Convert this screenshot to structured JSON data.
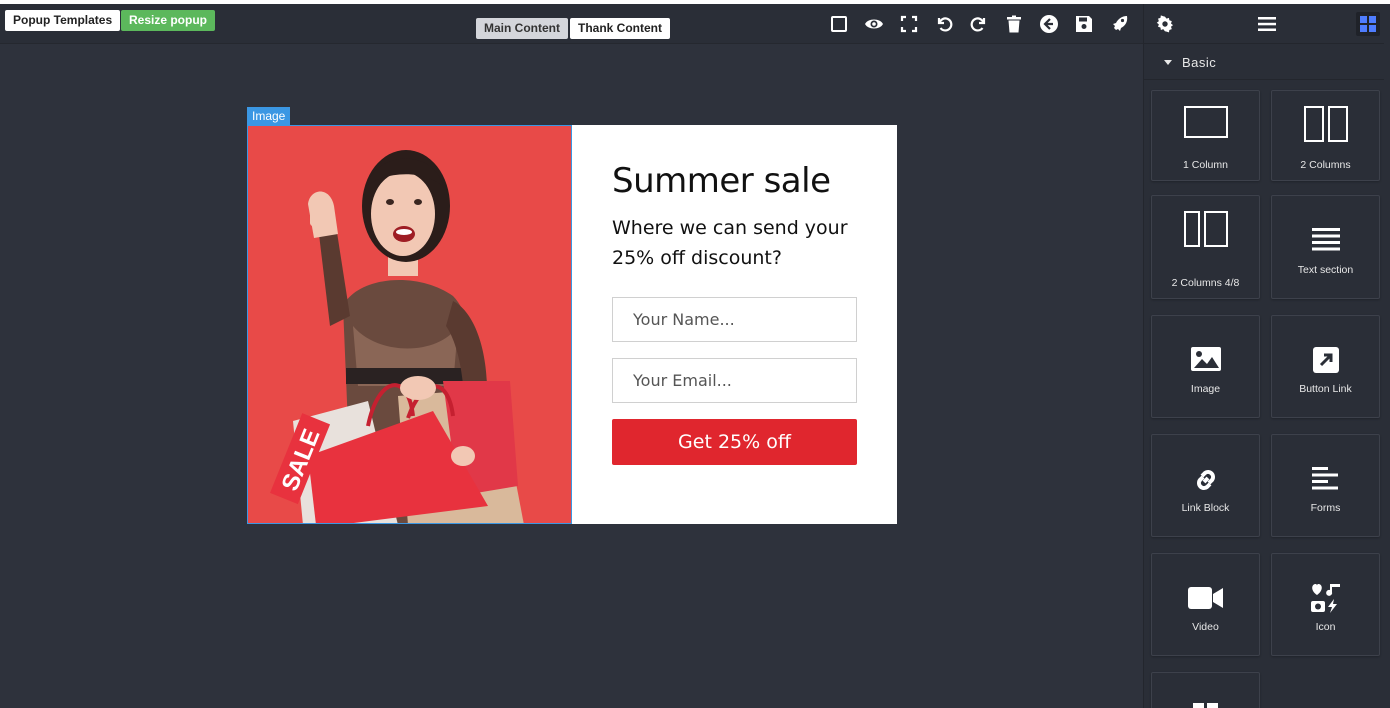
{
  "toolbar": {
    "popup_templates": "Popup Templates",
    "resize_popup": "Resize popup",
    "main_content": "Main Content",
    "thank_content": "Thank Content",
    "tools": [
      "square-outline-icon",
      "eye-icon",
      "fullscreen-icon",
      "undo-icon",
      "redo-icon",
      "trash-icon",
      "arrow-left-circle-icon",
      "save-icon",
      "rocket-icon"
    ]
  },
  "panel": {
    "tools": [
      "gear-icon",
      "menu-icon",
      "blocks-grid-icon"
    ],
    "section_label": "Basic",
    "blocks": [
      {
        "label": "1 Column",
        "icon": "one-column-icon"
      },
      {
        "label": "2 Columns",
        "icon": "two-columns-icon"
      },
      {
        "label": "2 Columns 4/8",
        "icon": "two-columns-4-8-icon"
      },
      {
        "label": "Text section",
        "icon": "text-lines-icon"
      },
      {
        "label": "Image",
        "icon": "image-icon"
      },
      {
        "label": "Button Link",
        "icon": "external-link-icon"
      },
      {
        "label": "Link Block",
        "icon": "link-icon"
      },
      {
        "label": "Forms",
        "icon": "forms-icon"
      },
      {
        "label": "Video",
        "icon": "video-camera-icon"
      },
      {
        "label": "Icon",
        "icon": "icons-collection-icon"
      }
    ]
  },
  "canvas": {
    "image_badge": "Image",
    "popup": {
      "title": "Summer sale",
      "subtitle": "Where we can send your 25% off discount?",
      "name_placeholder": "Your Name...",
      "email_placeholder": "Your Email...",
      "button_label": "Get 25% off",
      "image_bag_text": "SALE"
    }
  },
  "colors": {
    "background": "#2e323c",
    "panel": "#2a2e37",
    "resize_button": "#5cb85c",
    "image_background": "#e84a48",
    "cta_button": "#e0262e",
    "selection": "#3b97e3"
  }
}
